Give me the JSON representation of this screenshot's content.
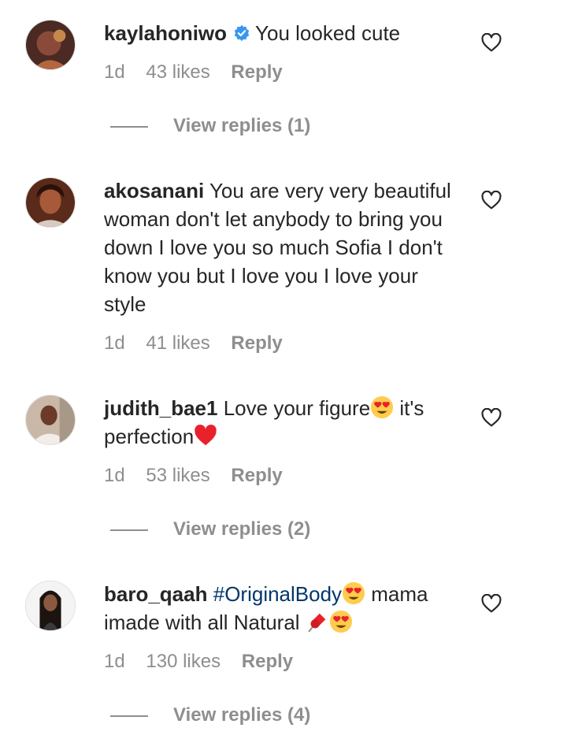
{
  "comments": [
    {
      "username": "kaylahoniwo",
      "verified": true,
      "text": "You looked cute",
      "time": "1d",
      "likes": "43 likes",
      "reply": "Reply",
      "view_replies": "View replies (1)"
    },
    {
      "username": "akosanani",
      "text": "You are very very beautiful woman don't let anybody to bring you down I love you so much Sofia I don't know you but I love you I love your style",
      "time": "1d",
      "likes": "41 likes",
      "reply": "Reply"
    },
    {
      "username": "judith_bae1",
      "text_part1": "Love your figure",
      "text_part2": " it's perfection",
      "time": "1d",
      "likes": "53 likes",
      "reply": "Reply",
      "view_replies": "View replies (2)"
    },
    {
      "username": "baro_qaah",
      "hashtag": "#OriginalBody",
      "text_part1": " mama imade with all Natural ",
      "time": "1d",
      "likes": "130 likes",
      "reply": "Reply",
      "view_replies": "View replies (4)"
    }
  ],
  "colors": {
    "text": "#262626",
    "secondary": "#8e8e8e",
    "hashtag": "#00376b",
    "verified": "#3897f0",
    "heart_red": "#e8212b"
  },
  "icons": [
    "heart-outline-icon",
    "verified-badge-icon",
    "heart-eyes-emoji",
    "red-heart-emoji",
    "pushpin-emoji"
  ]
}
